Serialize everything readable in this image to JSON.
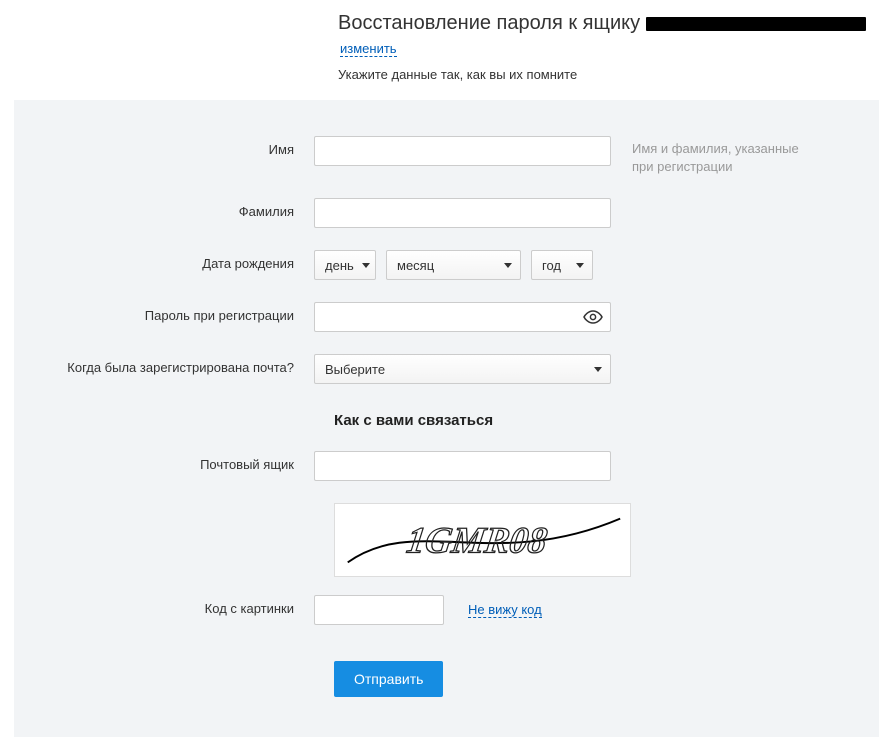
{
  "header": {
    "title_prefix": "Восстановление пароля к ящику",
    "change_link": "изменить",
    "subtitle": "Укажите данные так, как вы их помните"
  },
  "labels": {
    "first_name": "Имя",
    "last_name": "Фамилия",
    "dob": "Дата рождения",
    "password": "Пароль при регистрации",
    "registered_when": "Когда была зарегистрирована почта?",
    "mailbox": "Почтовый ящик",
    "captcha": "Код с картинки"
  },
  "hints": {
    "name": "Имя и фамилия, указанные при регистрации"
  },
  "selects": {
    "day": "день",
    "month": "месяц",
    "year": "год",
    "registered_when": "Выберите"
  },
  "section": {
    "contact_title": "Как с вами связаться"
  },
  "captcha": {
    "text": "1GMR08",
    "no_see": "Не вижу код"
  },
  "buttons": {
    "submit": "Отправить"
  }
}
